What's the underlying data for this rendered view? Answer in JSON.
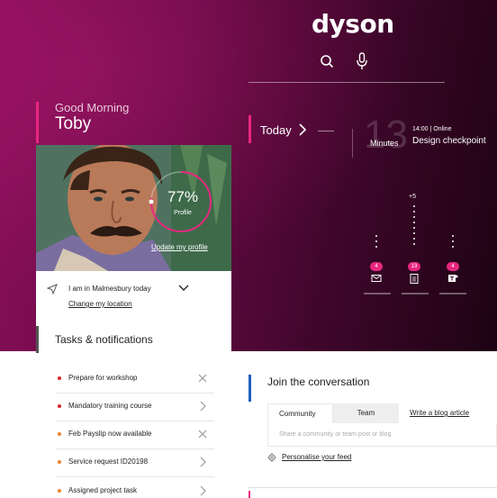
{
  "brand": {
    "logo_text": "dyson",
    "accent": "#e8277f",
    "blue_accent": "#1f5fbf"
  },
  "header": {
    "search_icon": "search-icon",
    "mic_icon": "microphone-icon"
  },
  "greeting": {
    "salutation": "Good Morning",
    "name": "Toby"
  },
  "profile": {
    "completion_label": "77%",
    "completion_fraction": 0.77,
    "caption": "Profile",
    "update_link": "Update my profile"
  },
  "location": {
    "text": "I am in Malmesbury today",
    "change_link": "Change my location"
  },
  "today": {
    "label": "Today",
    "countdown_value": "13",
    "countdown_unit": "Minutes",
    "meeting_meta": "14:00 | Online",
    "meeting_title": "Design checkpoint"
  },
  "quick_stats": [
    {
      "icon": "mail-icon",
      "count": "4"
    },
    {
      "icon": "clipboard-icon",
      "count": "13",
      "overflow": "+5"
    },
    {
      "icon": "teams-icon",
      "count": "4"
    }
  ],
  "tasks": {
    "title": "Tasks & notifications",
    "items": [
      {
        "label": "Prepare for workshop",
        "status_color": "#d9232e",
        "action": "close"
      },
      {
        "label": "Mandatory training course",
        "status_color": "#d9232e",
        "action": "chevron"
      },
      {
        "label": "Feb Payslip now available",
        "status_color": "#e8882a",
        "action": "close"
      },
      {
        "label": "Service request ID20198",
        "status_color": "#e8882a",
        "action": "chevron"
      },
      {
        "label": "Assigned project task",
        "status_color": "#e8882a",
        "action": "chevron"
      }
    ]
  },
  "conversation": {
    "title": "Join the conversation",
    "tabs": [
      "Community",
      "Team"
    ],
    "blog_link": "Write a blog article",
    "placeholder": "Share a community or team post or blog",
    "personalise": "Personalise your feed"
  }
}
